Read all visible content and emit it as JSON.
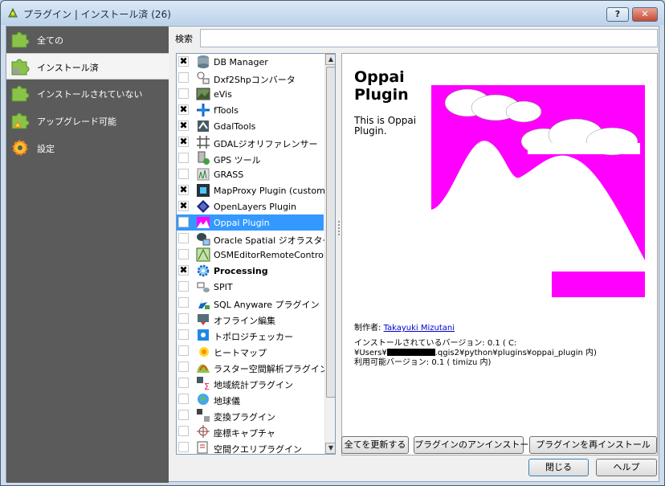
{
  "window": {
    "title": "プラグイン | インストール済 (26)",
    "help_button": "?",
    "close_button": "✕"
  },
  "sidebar": {
    "items": [
      {
        "label": "全ての",
        "icon": "puzzle-icon"
      },
      {
        "label": "インストール済",
        "icon": "puzzle-installed-icon",
        "selected": true
      },
      {
        "label": "インストールされていない",
        "icon": "puzzle-not-installed-icon"
      },
      {
        "label": "アップグレード可能",
        "icon": "puzzle-upgrade-icon"
      },
      {
        "label": "設定",
        "icon": "gear-icon"
      }
    ]
  },
  "search": {
    "label": "検索",
    "value": ""
  },
  "plugins": [
    {
      "label": "DB Manager",
      "checked": true
    },
    {
      "label": "Dxf2Shpコンバータ",
      "checked": false
    },
    {
      "label": "eVis",
      "checked": false
    },
    {
      "label": "fTools",
      "checked": true
    },
    {
      "label": "GdalTools",
      "checked": true
    },
    {
      "label": "GDALジオリファレンサー",
      "checked": true
    },
    {
      "label": "GPS ツール",
      "checked": false
    },
    {
      "label": "GRASS",
      "checked": false
    },
    {
      "label": "MapProxy Plugin (custom_",
      "checked": true
    },
    {
      "label": "OpenLayers Plugin",
      "checked": true
    },
    {
      "label": "Oppai Plugin",
      "checked": false,
      "selected": true
    },
    {
      "label": "Oracle Spatial ジオラスター",
      "checked": false
    },
    {
      "label": "OSMEditorRemoteControl",
      "checked": false
    },
    {
      "label": "Processing",
      "checked": true,
      "bold": true
    },
    {
      "label": "SPIT",
      "checked": false
    },
    {
      "label": "SQL Anyware プラグイン",
      "checked": false
    },
    {
      "label": "オフライン編集",
      "checked": false
    },
    {
      "label": "トポロジチェッカー",
      "checked": false
    },
    {
      "label": "ヒートマップ",
      "checked": false
    },
    {
      "label": "ラスター空間解析プラグイン",
      "checked": false
    },
    {
      "label": "地域統計プラグイン",
      "checked": false
    },
    {
      "label": "地球儀",
      "checked": false
    },
    {
      "label": "変換プラグイン",
      "checked": false
    },
    {
      "label": "座標キャプチャ",
      "checked": false
    },
    {
      "label": "空間クエリプラグイン",
      "checked": false
    }
  ],
  "detail": {
    "title": "Oppai Plugin",
    "description": "This is Oppai Plugin.",
    "author_label": "制作者:",
    "author_name": "Takayuki Mizutani",
    "installed_version_line1": "インストールされているバージョン: 0.1 ( C:",
    "installed_version_prefix": "¥Users¥",
    "installed_version_suffix": ".qgis2¥python¥plugins¥oppai_plugin 内)",
    "available_version": "利用可能バージョン: 0.1 ( timizu 内)",
    "image_bg_color": "#ff00ff"
  },
  "buttons": {
    "upgrade_all": "全てを更新する",
    "uninstall": "プラグインのアンインストール",
    "reinstall": "プラグインを再インストール",
    "close": "閉じる",
    "help": "ヘルプ"
  },
  "checkmark": "✖"
}
